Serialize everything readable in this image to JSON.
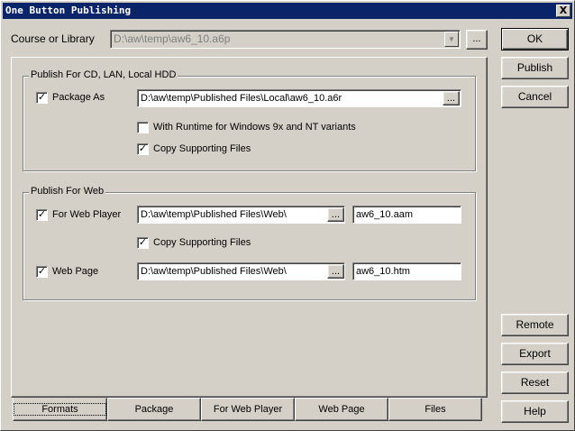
{
  "window": {
    "title": "One Button Publishing",
    "close_label": "X"
  },
  "course": {
    "label": "Course or Library",
    "value": "D:\\aw\\temp\\aw6_10.a6p",
    "browse_label": "..."
  },
  "side_buttons": {
    "ok": "OK",
    "publish": "Publish",
    "cancel": "Cancel",
    "remote": "Remote",
    "export": "Export",
    "reset": "Reset",
    "help": "Help"
  },
  "cd_group": {
    "title": "Publish For CD, LAN, Local HDD",
    "package_as": {
      "label": "Package As",
      "checked": true,
      "path": "D:\\aw\\temp\\Published Files\\Local\\aw6_10.a6r",
      "browse_label": "..."
    },
    "runtime": {
      "label": "With Runtime for Windows 9x and NT variants",
      "checked": false
    },
    "copy_support": {
      "label": "Copy Supporting Files",
      "checked": true
    }
  },
  "web_group": {
    "title": "Publish For Web",
    "web_player": {
      "label": "For Web Player",
      "checked": true,
      "path": "D:\\aw\\temp\\Published Files\\Web\\",
      "browse_label": "...",
      "filename": "aw6_10.aam"
    },
    "copy_support": {
      "label": "Copy Supporting Files",
      "checked": true
    },
    "web_page": {
      "label": "Web Page",
      "checked": true,
      "path": "D:\\aw\\temp\\Published Files\\Web\\",
      "browse_label": "...",
      "filename": "aw6_10.htm"
    }
  },
  "tabs": [
    {
      "label": "Formats",
      "active": true
    },
    {
      "label": "Package",
      "active": false
    },
    {
      "label": "For Web Player",
      "active": false
    },
    {
      "label": "Web Page",
      "active": false
    },
    {
      "label": "Files",
      "active": false
    }
  ],
  "check_glyph": "✓",
  "arrow_glyph": "▼"
}
